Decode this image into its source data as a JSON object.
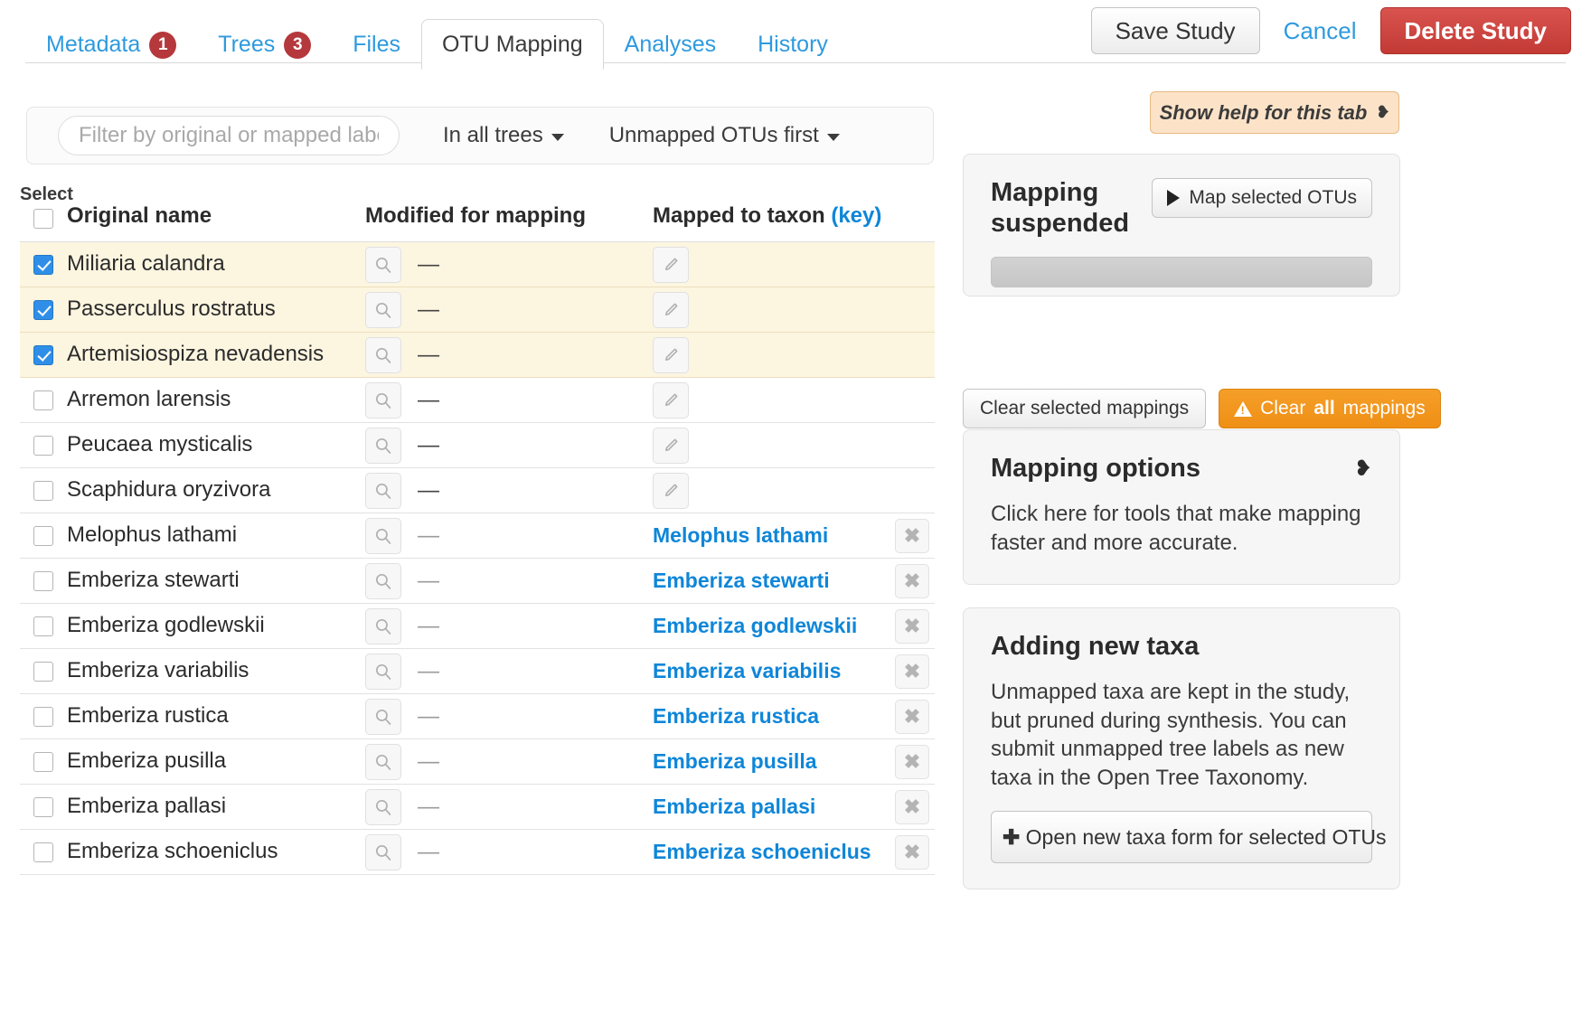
{
  "tabs": [
    {
      "label": "Metadata",
      "badge": "1",
      "active": false
    },
    {
      "label": "Trees",
      "badge": "3",
      "active": false
    },
    {
      "label": "Files",
      "badge": "",
      "active": false
    },
    {
      "label": "OTU Mapping",
      "badge": "",
      "active": true
    },
    {
      "label": "Analyses",
      "badge": "",
      "active": false
    },
    {
      "label": "History",
      "badge": "",
      "active": false
    }
  ],
  "header": {
    "save_label": "Save Study",
    "cancel_label": "Cancel",
    "delete_label": "Delete Study"
  },
  "help": {
    "label": "Show help for this tab",
    "chevron": "❥"
  },
  "filterbar": {
    "placeholder": "Filter by original or mapped label",
    "value": "",
    "trees_filter": "In all trees",
    "sort_order": "Unmapped OTUs first"
  },
  "table": {
    "select_label": "Select",
    "headers": {
      "original": "Original name",
      "modified": "Modified for mapping",
      "mapped": "Mapped to taxon",
      "mapped_key": "(key)"
    },
    "dash": "—",
    "rows": [
      {
        "original": "Miliaria calandra",
        "selected": true,
        "modified": "—",
        "mapped": "",
        "highlight": true
      },
      {
        "original": "Passerculus rostratus",
        "selected": true,
        "modified": "—",
        "mapped": "",
        "highlight": true
      },
      {
        "original": "Artemisiospiza nevadensis",
        "selected": true,
        "modified": "—",
        "mapped": "",
        "highlight": true
      },
      {
        "original": "Arremon larensis",
        "selected": false,
        "modified": "—",
        "mapped": "",
        "highlight": false
      },
      {
        "original": "Peucaea mysticalis",
        "selected": false,
        "modified": "—",
        "mapped": "",
        "highlight": false
      },
      {
        "original": "Scaphidura oryzivora",
        "selected": false,
        "modified": "—",
        "mapped": "",
        "highlight": false
      },
      {
        "original": "Melophus lathami",
        "selected": false,
        "modified": "—",
        "mapped": "Melophus lathami",
        "highlight": false
      },
      {
        "original": "Emberiza stewarti",
        "selected": false,
        "modified": "—",
        "mapped": "Emberiza stewarti",
        "highlight": false
      },
      {
        "original": "Emberiza godlewskii",
        "selected": false,
        "modified": "—",
        "mapped": "Emberiza godlewskii",
        "highlight": false
      },
      {
        "original": "Emberiza variabilis",
        "selected": false,
        "modified": "—",
        "mapped": "Emberiza variabilis",
        "highlight": false
      },
      {
        "original": "Emberiza rustica",
        "selected": false,
        "modified": "—",
        "mapped": "Emberiza rustica",
        "highlight": false
      },
      {
        "original": "Emberiza pusilla",
        "selected": false,
        "modified": "—",
        "mapped": "Emberiza pusilla",
        "highlight": false
      },
      {
        "original": "Emberiza pallasi",
        "selected": false,
        "modified": "—",
        "mapped": "Emberiza pallasi",
        "highlight": false
      },
      {
        "original": "Emberiza schoeniclus",
        "selected": false,
        "modified": "—",
        "mapped": "Emberiza schoeniclus",
        "highlight": false
      }
    ]
  },
  "sidebar": {
    "mapping": {
      "title": "Mapping suspended",
      "map_button": "Map selected OTUs",
      "progress_percent": 0
    },
    "clear_selected_label": "Clear selected mappings",
    "clear_all_prefix": "Clear ",
    "clear_all_strong": "all",
    "clear_all_suffix": " mappings",
    "options": {
      "title": "Mapping options",
      "chevron": "❥",
      "body": "Click here for tools that make mapping faster and more accurate."
    },
    "new_taxa": {
      "title": "Adding new taxa",
      "body": "Unmapped taxa are kept in the study, but pruned during synthesis. You can submit unmapped tree labels as new taxa in the Open Tree Taxonomy.",
      "button_plus": "✚",
      "button_label": "Open new taxa form for selected OTUs"
    }
  },
  "colors": {
    "link": "#2e9ade",
    "map_link": "#0f86d8",
    "badge": "#b5383c",
    "danger": "#c33a35",
    "warn": "#ef8f16",
    "highlight_row": "#fcf5e0",
    "help_bg": "#fce3c8"
  }
}
